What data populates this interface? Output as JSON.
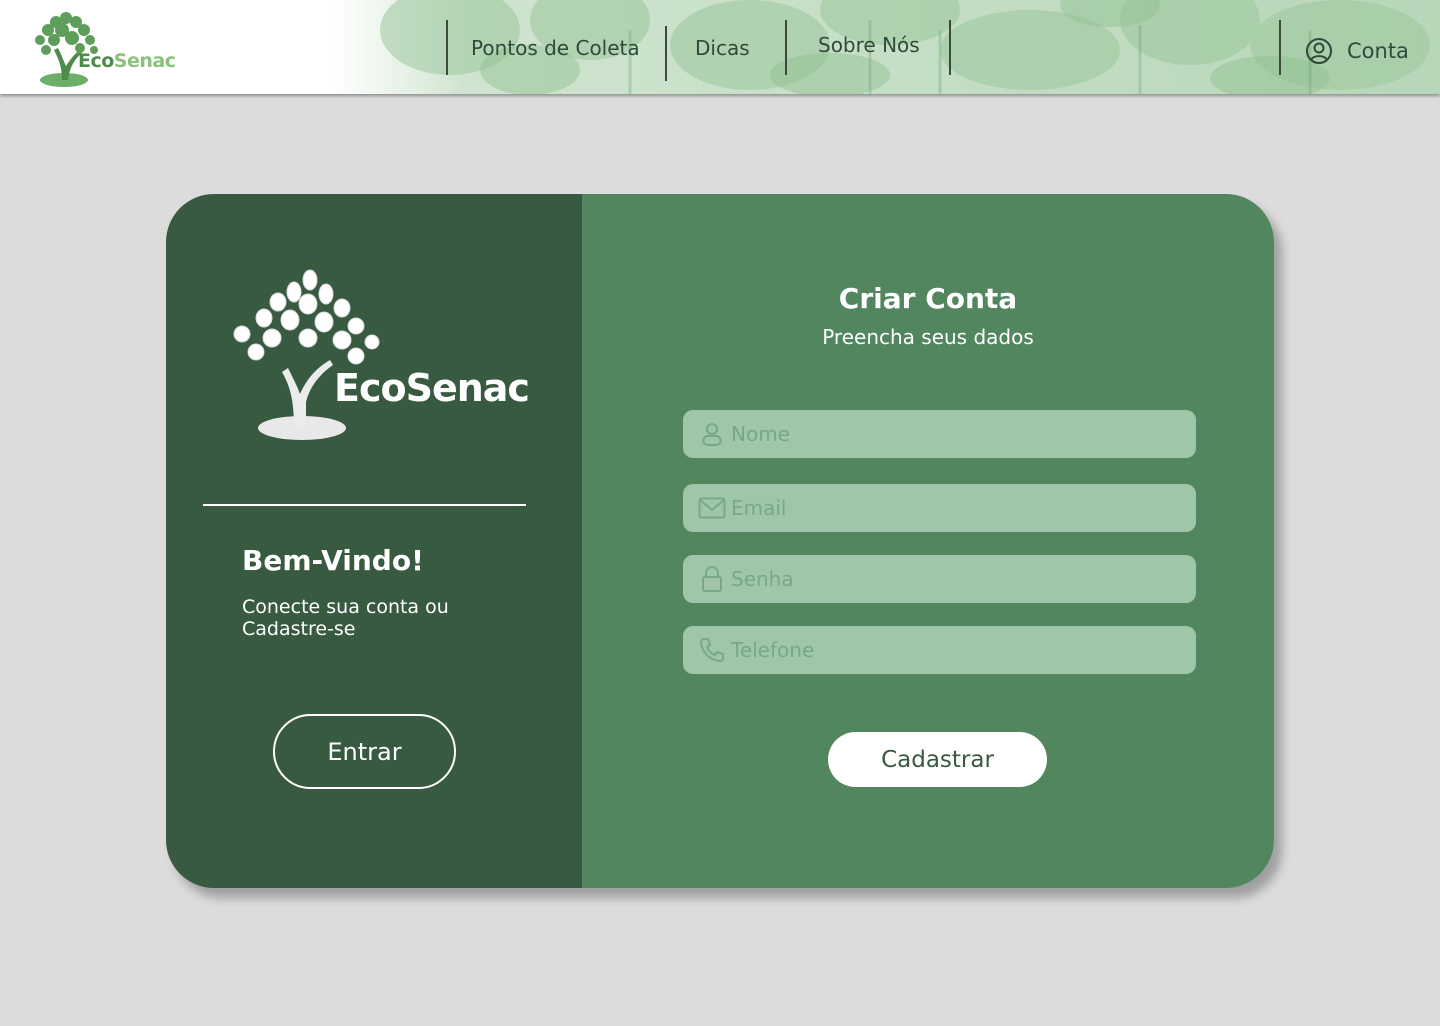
{
  "brand": {
    "logo_eco": "Eco",
    "logo_senac": "Senac",
    "logo_full": "EcoSenac"
  },
  "nav": {
    "items": [
      "Pontos de Coleta",
      "Dicas",
      "Sobre Nós"
    ],
    "account_label": "Conta",
    "account_icon": "user-circle-icon"
  },
  "welcome": {
    "title": "Bem-Vindo!",
    "subtitle": "Conecte sua conta ou Cadastre-se",
    "button_label": "Entrar"
  },
  "form": {
    "title": "Criar Conta",
    "subtitle": "Preencha seus dados",
    "fields": [
      {
        "placeholder": "Nome",
        "icon": "user-icon"
      },
      {
        "placeholder": "Email",
        "icon": "mail-icon"
      },
      {
        "placeholder": "Senha",
        "icon": "lock-icon"
      },
      {
        "placeholder": "Telefone",
        "icon": "phone-icon"
      }
    ],
    "submit_label": "Cadastrar"
  },
  "colors": {
    "page_bg": "#dcdcdc",
    "panel_left": "#375a41",
    "panel_right": "#52865f",
    "field_bg": "#a0c6a9",
    "accent": "#4d8c4b"
  }
}
